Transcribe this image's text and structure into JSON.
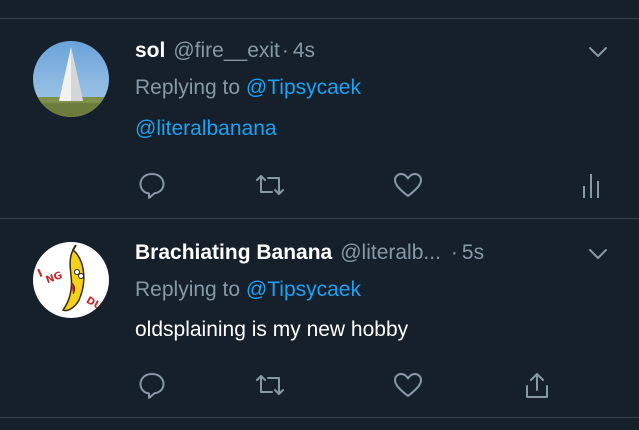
{
  "tweets": [
    {
      "name": "sol",
      "handle": "@fire__exit",
      "separator": "·",
      "time": "4s",
      "replying_prefix": "Replying to",
      "replying_to_1": "@Tipsycaek",
      "replying_to_2": "@literalbanana",
      "actions": [
        "reply-icon",
        "retweet-icon",
        "like-icon",
        "analytics-icon"
      ]
    },
    {
      "name": "Brachiating Banana",
      "handle": "@literalb...",
      "separator": "·",
      "time": "5s",
      "replying_prefix": "Replying to",
      "replying_to_1": "@Tipsycaek",
      "text": "oldsplaining is my new hobby",
      "actions": [
        "reply-icon",
        "retweet-icon",
        "like-icon",
        "share-icon"
      ]
    }
  ],
  "colors": {
    "background": "#15202b",
    "divider": "#38444d",
    "muted": "#8899a6",
    "link": "#1da1f2",
    "text": "#ffffff"
  }
}
